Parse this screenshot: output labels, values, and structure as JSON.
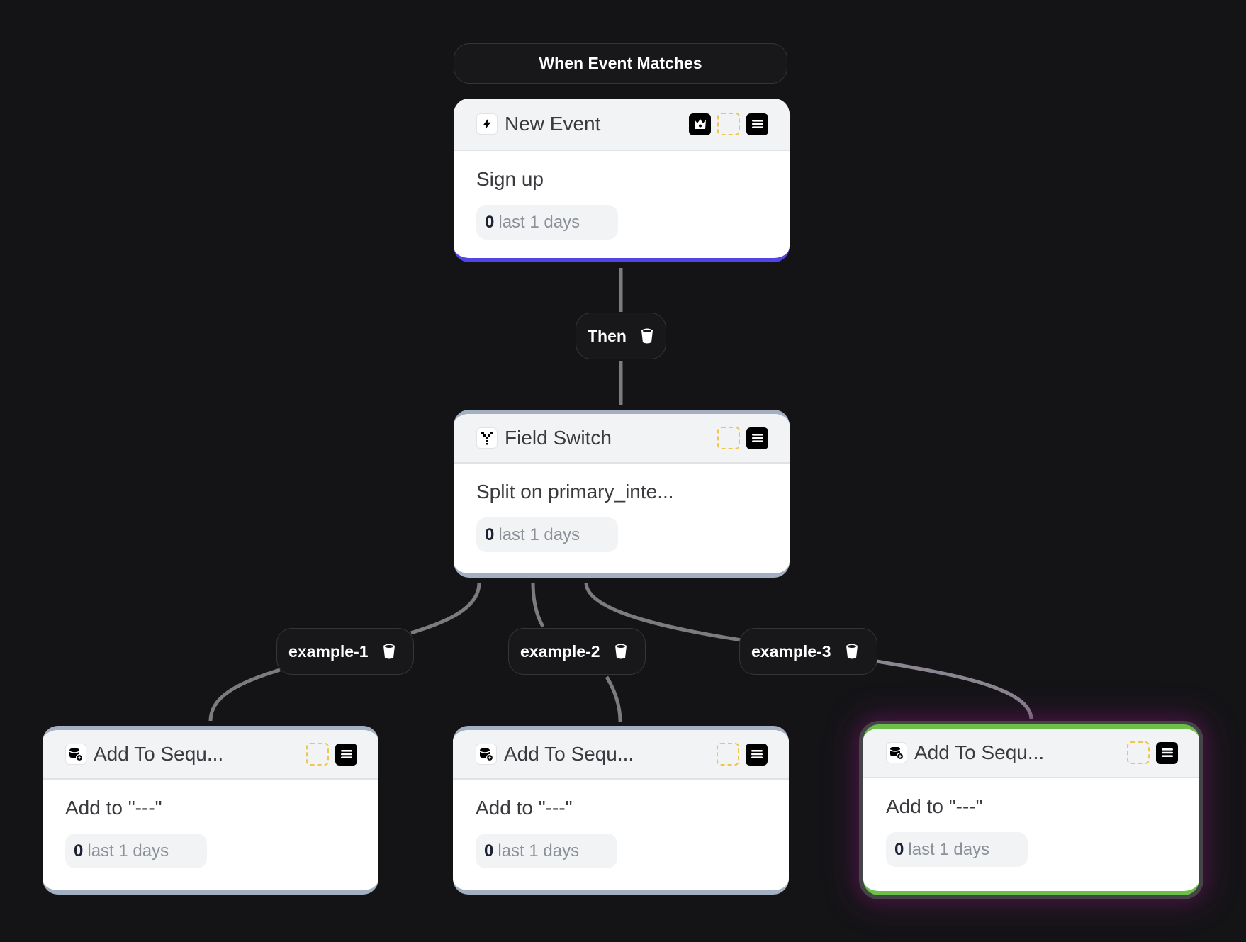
{
  "trigger": {
    "label": "When Event Matches"
  },
  "nodes": [
    {
      "id": "new-event",
      "title": "New Event",
      "icon": "lightning-icon",
      "description": "Sign up",
      "stat": {
        "count": "0",
        "period": "last 1 days"
      },
      "actions": [
        "crown-icon",
        "select-placeholder",
        "menu-icon"
      ],
      "accent": "#4f46e5"
    },
    {
      "id": "field-switch",
      "title": "Field Switch",
      "icon": "split-icon",
      "description": "Split on primary_inte...",
      "stat": {
        "count": "0",
        "period": "last 1 days"
      },
      "actions": [
        "select-placeholder",
        "menu-icon"
      ],
      "accent": "#a3b0c2"
    },
    {
      "id": "add-to-sequence-1",
      "title": "Add To Sequ...",
      "icon": "add-to-sequence-icon",
      "description": "Add to \"---\"",
      "stat": {
        "count": "0",
        "period": "last 1 days"
      },
      "actions": [
        "select-placeholder",
        "menu-icon"
      ],
      "accent": "#a3b0c2"
    },
    {
      "id": "add-to-sequence-2",
      "title": "Add To Sequ...",
      "icon": "add-to-sequence-icon",
      "description": "Add to \"---\"",
      "stat": {
        "count": "0",
        "period": "last 1 days"
      },
      "actions": [
        "select-placeholder",
        "menu-icon"
      ],
      "accent": "#a3b0c2"
    },
    {
      "id": "add-to-sequence-3",
      "title": "Add To Sequ...",
      "icon": "add-to-sequence-icon",
      "description": "Add to \"---\"",
      "stat": {
        "count": "0",
        "period": "last 1 days"
      },
      "actions": [
        "select-placeholder",
        "menu-icon"
      ],
      "accent": "#6cc04a",
      "selected": true
    }
  ],
  "edges": [
    {
      "label": "Then",
      "icon": "bucket-icon"
    },
    {
      "label": "example-1",
      "icon": "bucket-icon"
    },
    {
      "label": "example-2",
      "icon": "bucket-icon"
    },
    {
      "label": "example-3",
      "icon": "bucket-icon"
    }
  ],
  "colors": {
    "background": "#141417",
    "edge": "#7c7c7e",
    "selected_accent": "#6cc04a",
    "trigger_accent": "#4f46e5",
    "placeholder_dash": "#efc64d"
  }
}
